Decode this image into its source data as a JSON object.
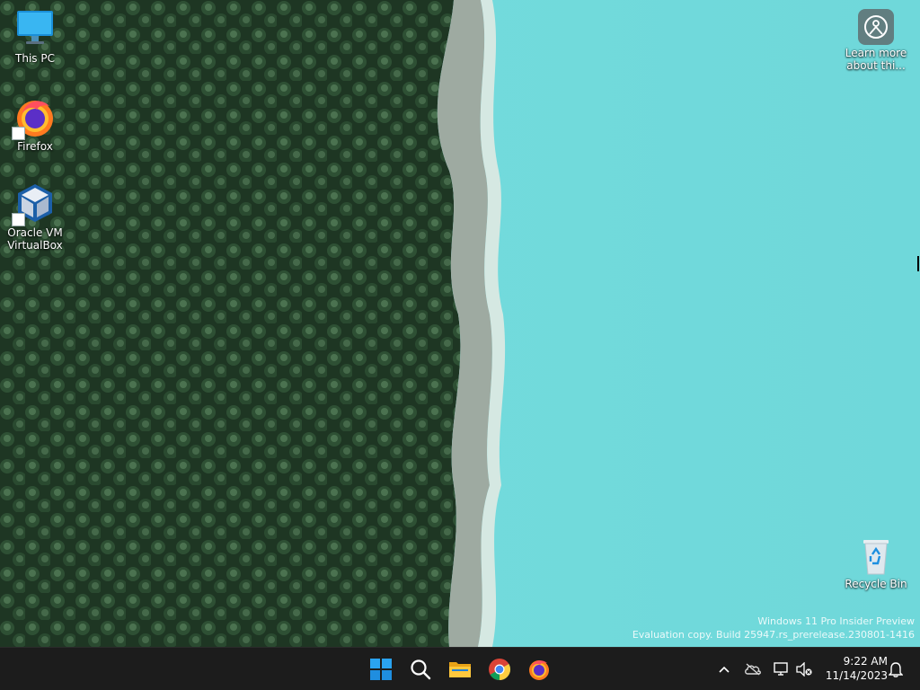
{
  "desktop": {
    "icons": [
      {
        "label": "This PC",
        "icon": "monitor-icon"
      },
      {
        "label": "Firefox",
        "icon": "firefox-icon"
      },
      {
        "label_line1": "Oracle VM",
        "label_line2": "VirtualBox",
        "icon": "virtualbox-icon"
      },
      {
        "label_line1": "Learn more",
        "label_line2": "about thi...",
        "icon": "spotlight-icon"
      },
      {
        "label": "Recycle Bin",
        "icon": "recycle-bin-icon"
      }
    ],
    "watermark": {
      "line1": "Windows 11 Pro Insider Preview",
      "line2": "Evaluation copy. Build 25947.rs_prerelease.230801-1416"
    },
    "colors": {
      "forest": "#1f3a25",
      "lake": "#6fd8da",
      "shore": "#c9d6cc"
    }
  },
  "taskbar": {
    "apps": [
      {
        "name": "Start",
        "icon": "windows-start-icon"
      },
      {
        "name": "Search",
        "icon": "search-icon"
      },
      {
        "name": "File Explorer",
        "icon": "folder-icon"
      },
      {
        "name": "Google Chrome",
        "icon": "chrome-icon"
      },
      {
        "name": "Firefox",
        "icon": "firefox-icon"
      }
    ],
    "tray": {
      "icons": [
        "chevron-up-icon",
        "onedrive-offline-icon",
        "network-icon",
        "volume-muted-icon",
        "notifications-bell-icon"
      ],
      "time": "9:22 AM",
      "date": "11/14/2023"
    },
    "colors": {
      "background": "#1c1c1c",
      "accent": "#0078d4"
    }
  }
}
